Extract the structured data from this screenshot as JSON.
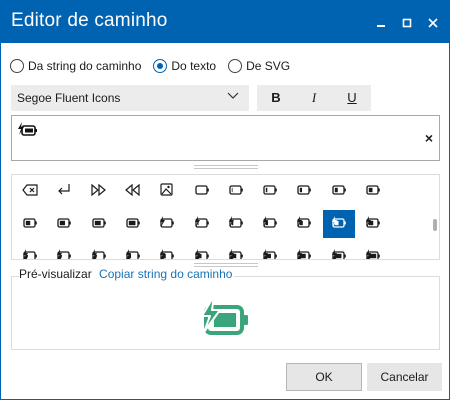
{
  "window": {
    "title": "Editor de caminho",
    "controls": {
      "minimize_icon": "minimize-icon",
      "maximize_icon": "maximize-icon",
      "close_icon": "close-icon"
    }
  },
  "source_options": [
    {
      "label": "Da string do caminho",
      "checked": false
    },
    {
      "label": "Do texto",
      "checked": true
    },
    {
      "label": "De SVG",
      "checked": false
    }
  ],
  "font": {
    "selected": "Segoe Fluent Icons"
  },
  "style_buttons": {
    "bold": "B",
    "italic": "I",
    "underline": "U"
  },
  "text_input": {
    "icon": "battery-charging-icon",
    "clear_label": "×"
  },
  "glyph_grid": {
    "rows": [
      [
        "backspace-icon",
        "return-icon",
        "fast-forward-icon",
        "rewind-icon",
        "image-icon",
        "battery-0-icon",
        "battery-1-icon",
        "battery-2-icon",
        "battery-3-icon",
        "battery-4-icon",
        "battery-5-icon"
      ],
      [
        "battery-6-icon",
        "battery-7-icon",
        "battery-8-icon",
        "battery-9-icon",
        "battery-charging-0-icon",
        "battery-charging-1-icon",
        "battery-charging-2-icon",
        "battery-charging-3-icon",
        "battery-charging-4-icon",
        "battery-charging-5-icon",
        "battery-charging-6-icon"
      ],
      [
        "battery-saver-0-icon",
        "battery-saver-1-icon",
        "battery-saver-2-icon",
        "battery-saver-3-icon",
        "battery-saver-4-icon",
        "battery-saver-5-icon",
        "battery-saver-6-icon",
        "battery-saver-7-icon",
        "battery-saver-8-icon",
        "battery-saver-9-icon",
        "battery-saver-10-icon"
      ]
    ],
    "selected": {
      "row": 1,
      "col": 9
    }
  },
  "preview": {
    "label": "Pré-visualizar",
    "copy_link": "Copiar string do caminho",
    "icon": "battery-charging-icon",
    "color": "#3aa57a"
  },
  "buttons": {
    "ok": "OK",
    "cancel": "Cancelar"
  },
  "colors": {
    "accent": "#0063b1",
    "preview": "#3aa57a",
    "link": "#1a73b6"
  }
}
